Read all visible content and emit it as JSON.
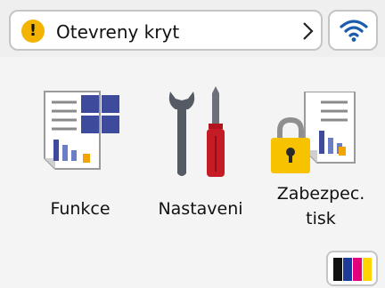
{
  "status_bar": {
    "alert_text": "Otevreny kryt",
    "alert_icon": "warning-icon",
    "network_icon": "wifi-icon",
    "warning_color": "#f2b400"
  },
  "apps": [
    {
      "label": "Funkce",
      "icon": "functions-icon"
    },
    {
      "label": "Nastaveni",
      "icon": "settings-tools-icon"
    },
    {
      "label_lines": [
        "Zabezpec.",
        "tisk"
      ],
      "icon": "secure-print-icon"
    }
  ],
  "ink": {
    "icon": "ink-toner-icon",
    "colors": [
      "#111111",
      "#1e3a9a",
      "#e3007a",
      "#ffd400"
    ]
  }
}
